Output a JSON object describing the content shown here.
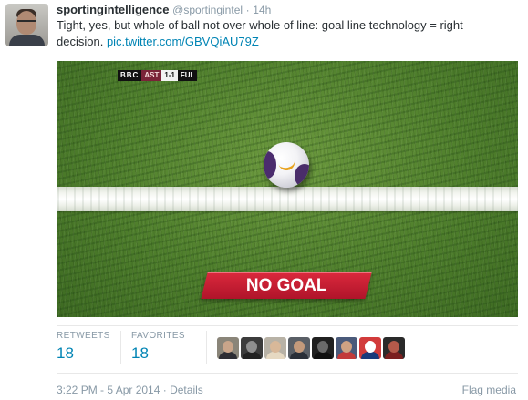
{
  "tweet": {
    "display_name": "sportingintelligence",
    "handle": "@sportingintel",
    "separator": "·",
    "age": "14h",
    "text_line1": "Tight, yes, but whole of ball not over whole of line: goal line technology = right",
    "text_line2": "decision.",
    "link": "pic.twitter.com/GBVQiAU79Z"
  },
  "media": {
    "scorebug": {
      "broadcaster": "BBC",
      "home": "AST",
      "score": "1-1",
      "away": "FUL"
    },
    "banner": "NO GOAL"
  },
  "stats": {
    "retweets_label": "RETWEETS",
    "retweets_value": "18",
    "favorites_label": "FAVORITES",
    "favorites_value": "18"
  },
  "favoriters": [
    {
      "icon": "user-avatar-1",
      "bg": "#8a8579",
      "head": "#c9a58a",
      "body": "#2d2d33"
    },
    {
      "icon": "user-avatar-2",
      "bg": "#3c3c3c",
      "head": "#8f8f8f",
      "body": "#222222"
    },
    {
      "icon": "user-avatar-3",
      "bg": "#b8b2a6",
      "head": "#d8b899",
      "body": "#e6d9c2"
    },
    {
      "icon": "user-avatar-4",
      "bg": "#5a5f66",
      "head": "#c49a7b",
      "body": "#2a2f38"
    },
    {
      "icon": "user-avatar-5",
      "bg": "#202020",
      "head": "#6a6a6a",
      "body": "#101010"
    },
    {
      "icon": "user-avatar-6",
      "bg": "#4a5a7a",
      "head": "#cfa283",
      "body": "#c23a3a"
    },
    {
      "icon": "user-avatar-7",
      "bg": "#d23b3b",
      "head": "#ffffff",
      "body": "#1a3a7a"
    },
    {
      "icon": "user-avatar-8",
      "bg": "#2a2a2a",
      "head": "#b35a4a",
      "body": "#7a1f1f"
    }
  ],
  "footer": {
    "timestamp": "3:22 PM - 5 Apr 2014",
    "separator": "·",
    "details": "Details",
    "flag": "Flag media"
  }
}
